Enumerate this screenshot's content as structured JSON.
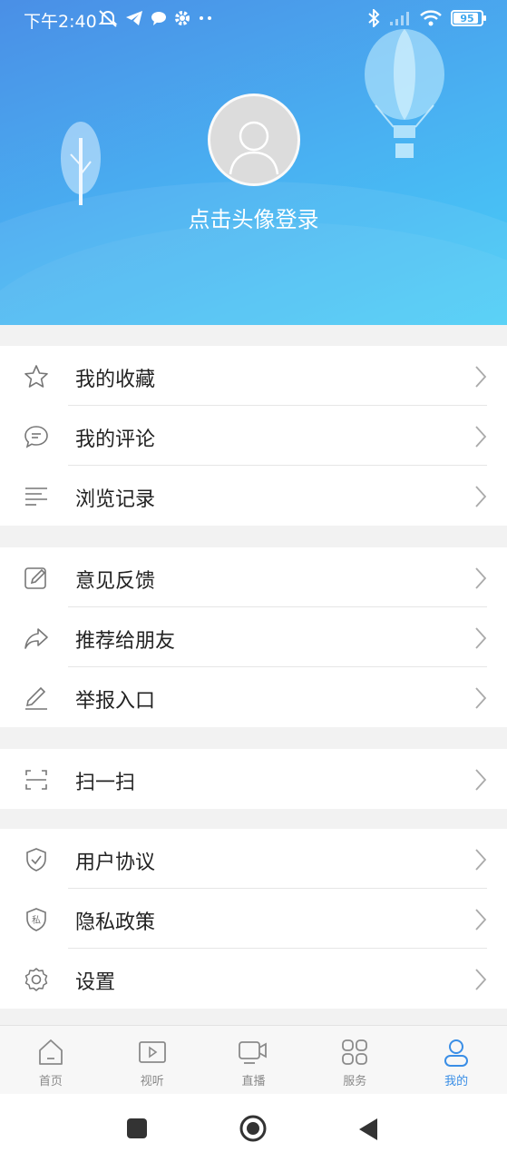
{
  "status_bar": {
    "time": "下午2:40",
    "battery": "95"
  },
  "profile": {
    "login_prompt": "点击头像登录"
  },
  "menu_groups": [
    [
      {
        "label": "我的收藏",
        "icon": "star-icon"
      },
      {
        "label": "我的评论",
        "icon": "comment-icon"
      },
      {
        "label": "浏览记录",
        "icon": "history-list-icon"
      }
    ],
    [
      {
        "label": "意见反馈",
        "icon": "feedback-edit-icon"
      },
      {
        "label": "推荐给朋友",
        "icon": "share-icon"
      },
      {
        "label": "举报入口",
        "icon": "pencil-icon"
      }
    ],
    [
      {
        "label": "扫一扫",
        "icon": "scan-icon"
      }
    ],
    [
      {
        "label": "用户协议",
        "icon": "shield-check-icon"
      },
      {
        "label": "隐私政策",
        "icon": "privacy-shield-icon"
      },
      {
        "label": "设置",
        "icon": "gear-icon"
      }
    ]
  ],
  "tab_bar": [
    {
      "label": "首页",
      "icon": "home-icon",
      "active": false
    },
    {
      "label": "视听",
      "icon": "video-play-icon",
      "active": false
    },
    {
      "label": "直播",
      "icon": "live-camera-icon",
      "active": false
    },
    {
      "label": "服务",
      "icon": "grid-icon",
      "active": false
    },
    {
      "label": "我的",
      "icon": "user-icon",
      "active": true
    }
  ],
  "colors": {
    "header_start": "#4a8fe6",
    "header_end": "#46cdf6",
    "accent": "#3a8ee6"
  }
}
